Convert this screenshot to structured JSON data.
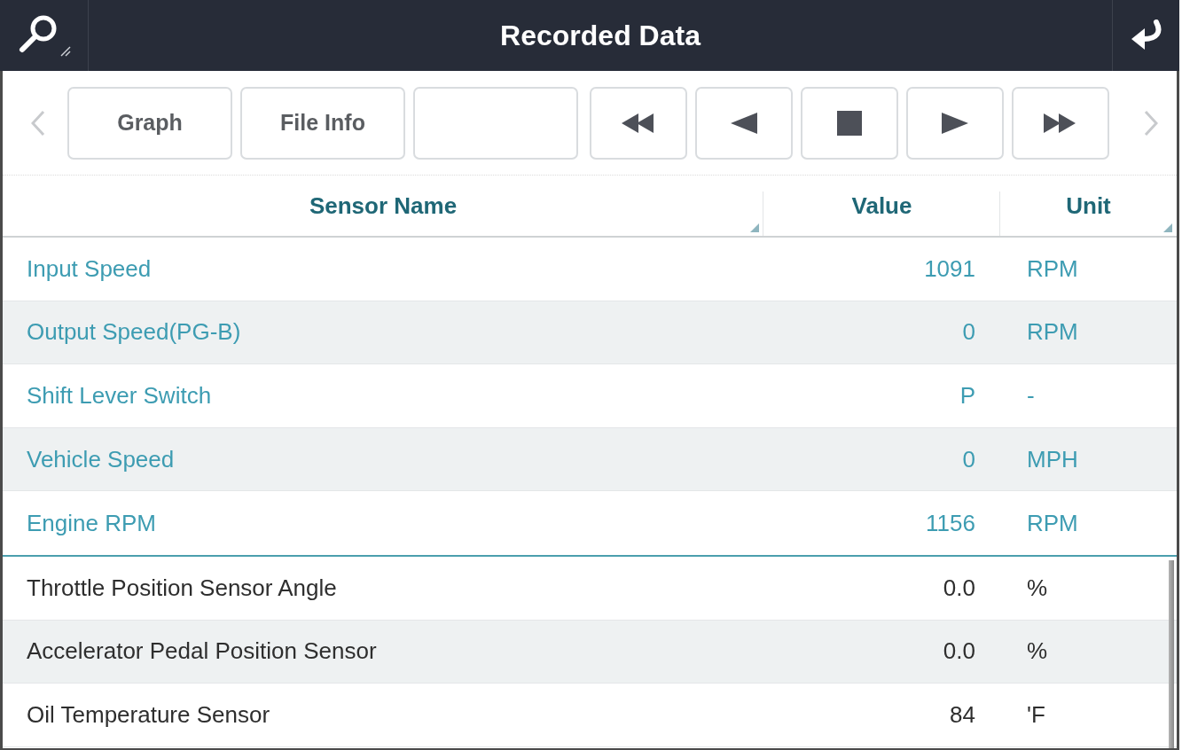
{
  "header": {
    "title": "Recorded Data"
  },
  "toolbar": {
    "text_buttons": [
      "Graph",
      "File Info"
    ]
  },
  "table": {
    "columns": [
      {
        "label": "Sensor Name",
        "grip": true
      },
      {
        "label": "Value",
        "grip": false
      },
      {
        "label": "Unit",
        "grip": true
      }
    ],
    "pinned_rows": [
      {
        "name": "Input Speed",
        "value": "1091",
        "unit": "RPM"
      },
      {
        "name": "Output Speed(PG-B)",
        "value": "0",
        "unit": "RPM"
      },
      {
        "name": "Shift Lever Switch",
        "value": "P",
        "unit": "-"
      },
      {
        "name": "Vehicle Speed",
        "value": "0",
        "unit": "MPH"
      },
      {
        "name": "Engine RPM",
        "value": "1156",
        "unit": "RPM"
      }
    ],
    "rows": [
      {
        "name": "Throttle Position Sensor Angle",
        "value": "0.0",
        "unit": "%"
      },
      {
        "name": "Accelerator Pedal Position Sensor",
        "value": "0.0",
        "unit": "%"
      },
      {
        "name": "Oil Temperature Sensor",
        "value": "84",
        "unit": "'F"
      }
    ]
  }
}
